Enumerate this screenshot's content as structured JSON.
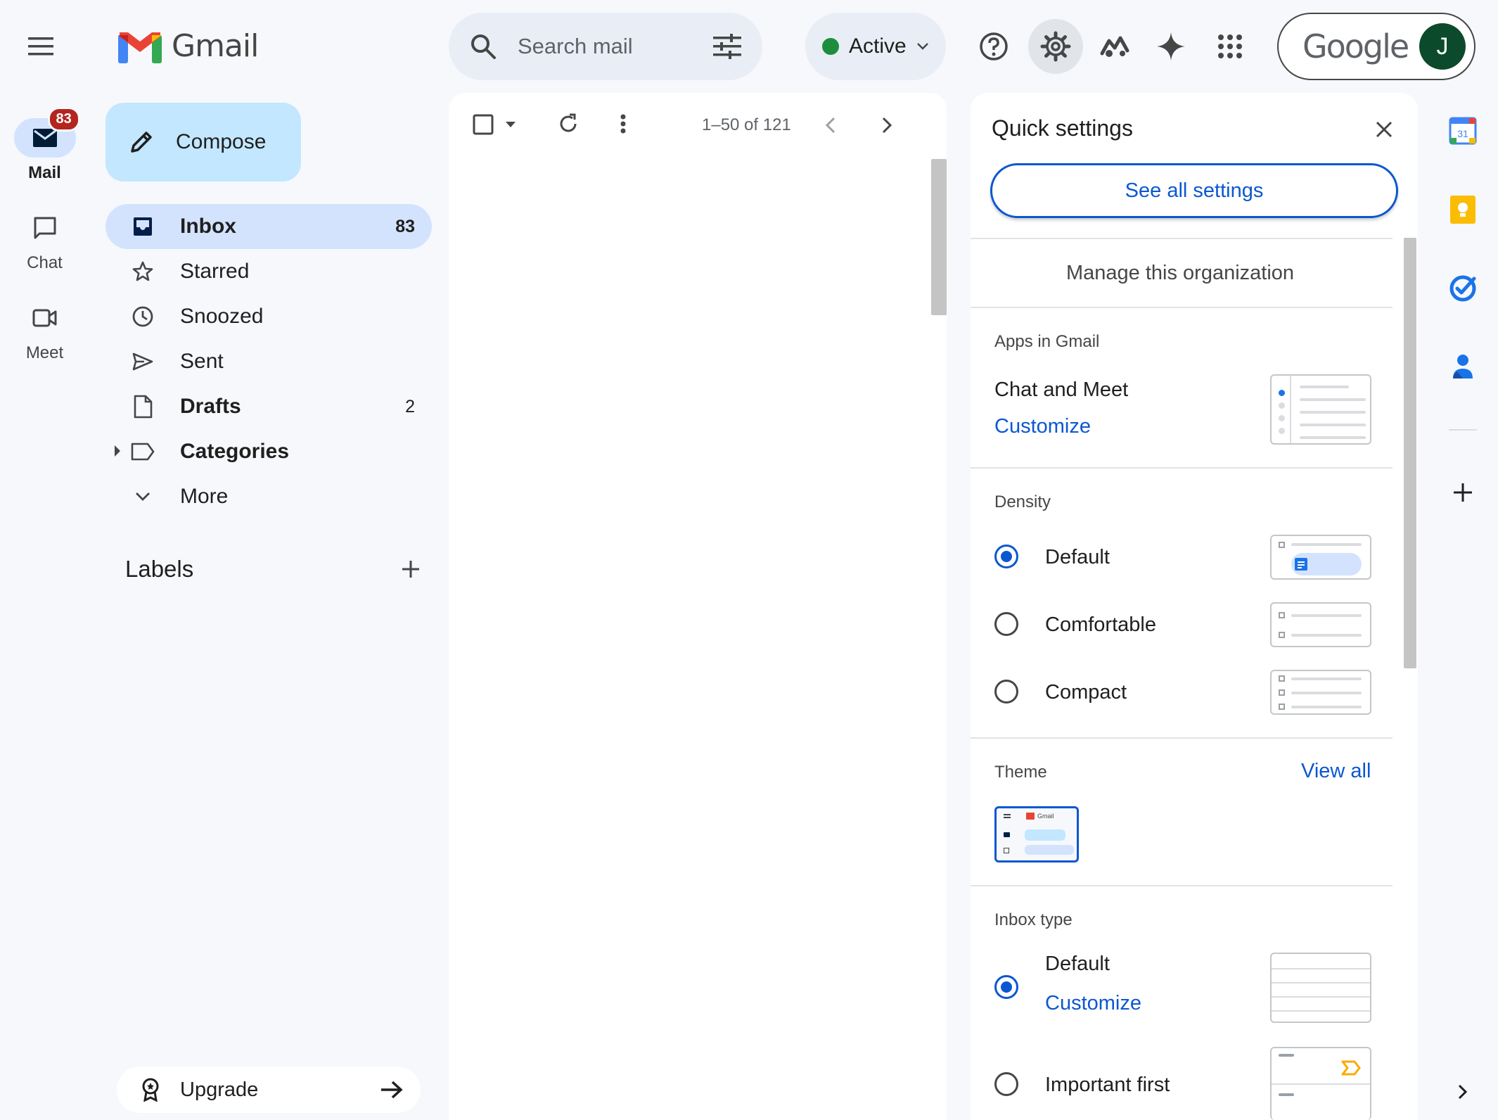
{
  "rail": {
    "mail_label": "Mail",
    "mail_badge": "83",
    "chat_label": "Chat",
    "meet_label": "Meet"
  },
  "header": {
    "logo_text": "Gmail",
    "search_placeholder": "Search mail",
    "status_label": "Active",
    "google_text": "Google",
    "avatar_initial": "J"
  },
  "nav": {
    "compose_label": "Compose",
    "items": [
      {
        "label": "Inbox",
        "count": "83"
      },
      {
        "label": "Starred",
        "count": ""
      },
      {
        "label": "Snoozed",
        "count": ""
      },
      {
        "label": "Sent",
        "count": ""
      },
      {
        "label": "Drafts",
        "count": "2"
      },
      {
        "label": "Categories",
        "count": ""
      },
      {
        "label": "More",
        "count": ""
      }
    ],
    "labels_heading": "Labels",
    "upgrade_label": "Upgrade"
  },
  "list": {
    "range_text": "1–50 of 121"
  },
  "quick_settings": {
    "title": "Quick settings",
    "see_all": "See all settings",
    "manage_org": "Manage this organization",
    "apps_heading": "Apps in Gmail",
    "apps_row": "Chat and Meet",
    "apps_customize": "Customize",
    "density_heading": "Density",
    "density_options": [
      "Default",
      "Comfortable",
      "Compact"
    ],
    "density_selected": "Default",
    "theme_heading": "Theme",
    "theme_view_all": "View all",
    "theme_thumb_text": "Gmail",
    "inbox_type_heading": "Inbox type",
    "inbox_options": [
      "Default",
      "Important first"
    ],
    "inbox_customize": "Customize",
    "inbox_selected": "Default"
  },
  "side_panel": {
    "calendar_day": "31"
  },
  "colors": {
    "accent": "#0b57d0",
    "nav_active": "#d3e3fd",
    "compose_bg": "#c2e7ff",
    "badge": "#b3261e",
    "status_dot": "#1e8e3e"
  }
}
